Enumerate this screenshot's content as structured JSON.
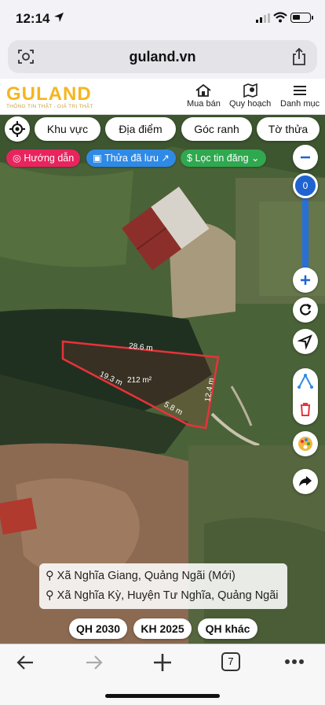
{
  "status": {
    "time": "12:14"
  },
  "browser": {
    "url": "guland.vn",
    "tab_count": "7"
  },
  "header": {
    "brand": "GULAND",
    "tagline": "THÔNG TIN THẬT - GIÁ TRỊ THẬT",
    "nav": [
      {
        "label": "Mua bán",
        "icon": "house-icon"
      },
      {
        "label": "Quy hoạch",
        "icon": "map-pin-icon"
      },
      {
        "label": "Danh mục",
        "icon": "menu-icon"
      }
    ]
  },
  "chips": [
    "Khu vực",
    "Địa điểm",
    "Góc ranh",
    "Tờ thửa"
  ],
  "pills": {
    "guide": "Hướng dẫn",
    "saved": "Thửa đã lưu",
    "filter": "Lọc tin đăng"
  },
  "colors": {
    "guide": "#e8245e",
    "saved": "#2f8ae6",
    "filter": "#2fa84f",
    "parcel": "#e8323a",
    "brand": "#f6b51e",
    "accent": "#1e63d0"
  },
  "zoom": {
    "value": "0"
  },
  "parcel": {
    "top_edge": "28.6 m",
    "left_edge": "19.3 m",
    "area": "212 m²",
    "bottom_edge": "5.8 m",
    "right_edge": "12.4 m"
  },
  "address": {
    "line1": "Xã Nghĩa Giang, Quảng Ngãi (Mới)",
    "line2": "Xã Nghĩa Kỳ, Huyện Tư Nghĩa, Quảng Ngãi"
  },
  "plans": [
    "QH 2030",
    "KH 2025",
    "QH khác"
  ]
}
